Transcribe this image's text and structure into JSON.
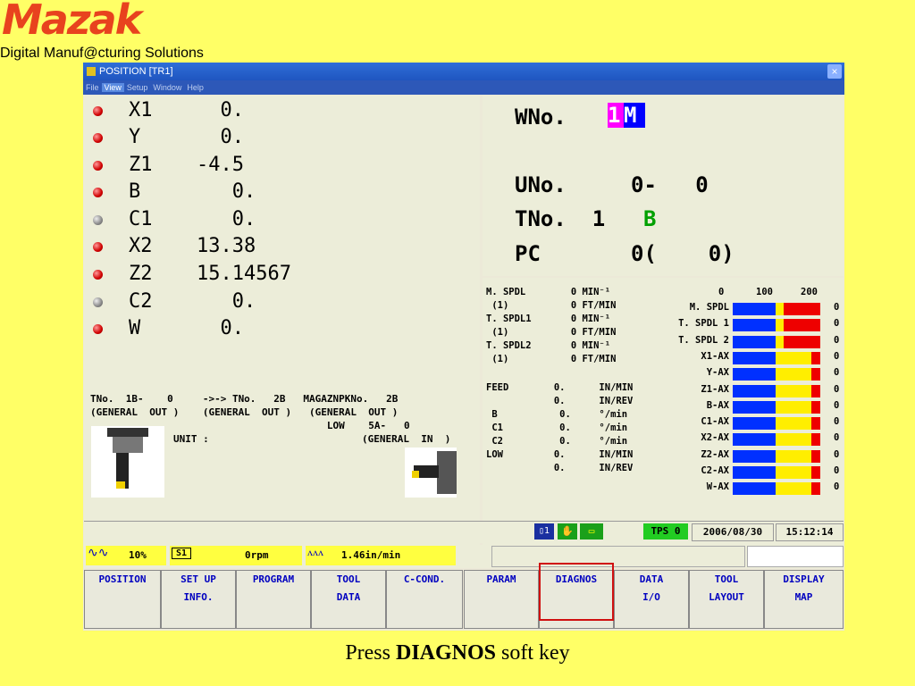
{
  "brand": {
    "logo": "Mazak",
    "tagline": "Digital Manuf@cturing Solutions"
  },
  "window": {
    "title": "POSITION [TR1]",
    "close": "×"
  },
  "menu": [
    "File",
    "View",
    "Setup",
    "Window",
    "Help"
  ],
  "axes": [
    {
      "name": "X1",
      "value": "  0.",
      "status": "red"
    },
    {
      "name": "Y",
      "value": "  0.",
      "status": "red"
    },
    {
      "name": "Z1",
      "value": "-4.5",
      "status": "red"
    },
    {
      "name": "B",
      "value": "   0.",
      "status": "red"
    },
    {
      "name": "C1",
      "value": "   0.",
      "status": "gray"
    },
    {
      "name": "X2",
      "value": "13.38",
      "status": "red"
    },
    {
      "name": "Z2",
      "value": "15.14567",
      "status": "red"
    },
    {
      "name": "C2",
      "value": "   0.",
      "status": "gray"
    },
    {
      "name": "W",
      "value": "  0.",
      "status": "red"
    }
  ],
  "tool_info": {
    "line1": "TNo.  1B-    0     ->-> TNo.   2B   MAGAZNPKNo.   2B",
    "line2": "(GENERAL  OUT )    (GENERAL  OUT )   (GENERAL  OUT )",
    "line3": "                                        LOW    5A-   0",
    "unit": "UNIT :",
    "line4": "(GENERAL  IN  )"
  },
  "status": {
    "wno_label": "WNo.",
    "wno_value_1": "1",
    "wno_value_2": "M",
    "uno": "UNo.     0-   0",
    "tno_label": "TNo.  1",
    "tno_suffix": "B",
    "pc": "PC       0(    0)"
  },
  "spindle": {
    "lines": [
      "M. SPDL        0 MIN⁻¹",
      " (1)           0 FT/MIN",
      "T. SPDL1       0 MIN⁻¹",
      " (1)           0 FT/MIN",
      "T. SPDL2       0 MIN⁻¹",
      " (1)           0 FT/MIN"
    ],
    "feed": [
      "FEED        0.      IN/MIN",
      "            0.      IN/REV",
      " B           0.     °/min",
      " C1          0.     °/min",
      " C2          0.     °/min",
      "LOW         0.      IN/MIN",
      "            0.      IN/REV"
    ]
  },
  "load_meter": {
    "scale": [
      "0",
      "100",
      "200"
    ],
    "rows": [
      {
        "label": "M. SPDL",
        "value": "0"
      },
      {
        "label": "T. SPDL 1",
        "value": "0"
      },
      {
        "label": "T. SPDL 2",
        "value": "0"
      },
      {
        "label": "X1-AX",
        "value": "0"
      },
      {
        "label": "Y-AX",
        "value": "0"
      },
      {
        "label": "Z1-AX",
        "value": "0"
      },
      {
        "label": "B-AX",
        "value": "0"
      },
      {
        "label": "C1-AX",
        "value": "0"
      },
      {
        "label": "X2-AX",
        "value": "0"
      },
      {
        "label": "Z2-AX",
        "value": "0"
      },
      {
        "label": "C2-AX",
        "value": "0"
      },
      {
        "label": "W-AX",
        "value": "0"
      }
    ]
  },
  "statusbar": {
    "tps": "TPS 0",
    "date": "2006/08/30",
    "time": "15:12:14"
  },
  "override": {
    "spindle_pct": "10%",
    "spindle_label": "S1",
    "rpm": "0rpm",
    "feed": "1.46in/min"
  },
  "softkeys": [
    {
      "l1": "POSITION",
      "l2": ""
    },
    {
      "l1": "SET UP",
      "l2": "INFO."
    },
    {
      "l1": "PROGRAM",
      "l2": ""
    },
    {
      "l1": "TOOL",
      "l2": "DATA"
    },
    {
      "l1": "C-COND.",
      "l2": ""
    },
    {
      "l1": "PARAM",
      "l2": ""
    },
    {
      "l1": "DIAGNOS",
      "l2": ""
    },
    {
      "l1": "DATA",
      "l2": "I/O"
    },
    {
      "l1": "TOOL",
      "l2": "LAYOUT"
    },
    {
      "l1": "DISPLAY",
      "l2": "MAP"
    }
  ],
  "caption": {
    "pre": "Press ",
    "bold": "DIAGNOS",
    "post": " soft key"
  },
  "colors": {
    "background": "#ffff66",
    "highlight": "#d01010",
    "softkey_text": "#0000c0"
  }
}
